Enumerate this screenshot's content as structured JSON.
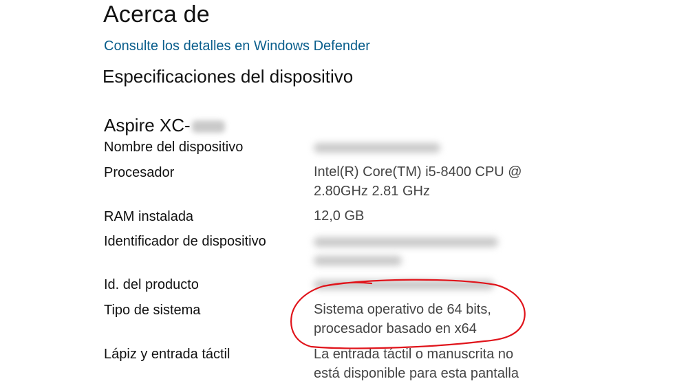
{
  "page": {
    "title": "Acerca de",
    "defender_link": "Consulte los detalles en Windows Defender",
    "section_heading": "Especificaciones del dispositivo"
  },
  "device": {
    "model_name": "Aspire XC-",
    "specs": {
      "device_name": {
        "label": "Nombre del dispositivo"
      },
      "processor": {
        "label": "Procesador",
        "value_line1": "Intel(R) Core(TM) i5-8400 CPU @",
        "value_line2": "2.80GHz   2.81 GHz"
      },
      "ram": {
        "label": "RAM instalada",
        "value": "12,0 GB"
      },
      "device_id": {
        "label": "Identificador de dispositivo"
      },
      "product_id": {
        "label": "Id. del producto"
      },
      "system_type": {
        "label": "Tipo de sistema",
        "value_line1": "Sistema operativo de 64 bits,",
        "value_line2": "procesador basado en x64"
      },
      "pen_touch": {
        "label": "Lápiz y entrada táctil",
        "value_line1": "La entrada táctil o manuscrita no",
        "value_line2": "está disponible para esta pantalla"
      }
    }
  },
  "annotation": {
    "color": "#e0141b"
  }
}
